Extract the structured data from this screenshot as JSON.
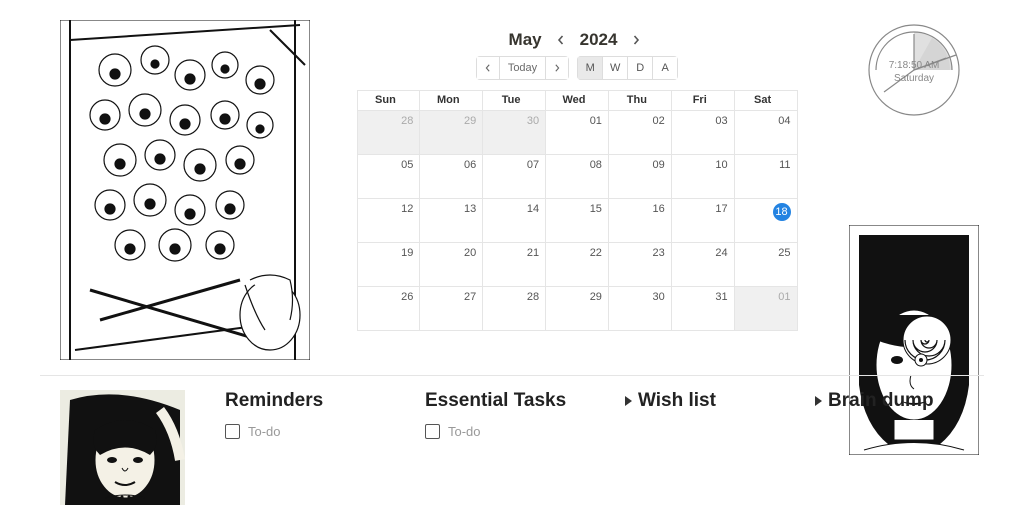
{
  "calendar": {
    "month": "May",
    "year": "2024",
    "today_label": "Today",
    "views": {
      "m": "M",
      "w": "W",
      "d": "D",
      "a": "A",
      "active": "M"
    },
    "weekdays": [
      "Sun",
      "Mon",
      "Tue",
      "Wed",
      "Thu",
      "Fri",
      "Sat"
    ],
    "weeks": [
      [
        {
          "d": "28",
          "muted": true
        },
        {
          "d": "29",
          "muted": true
        },
        {
          "d": "30",
          "muted": true
        },
        {
          "d": "01"
        },
        {
          "d": "02"
        },
        {
          "d": "03"
        },
        {
          "d": "04"
        }
      ],
      [
        {
          "d": "05"
        },
        {
          "d": "06"
        },
        {
          "d": "07"
        },
        {
          "d": "08"
        },
        {
          "d": "09"
        },
        {
          "d": "10"
        },
        {
          "d": "11"
        }
      ],
      [
        {
          "d": "12"
        },
        {
          "d": "13"
        },
        {
          "d": "14"
        },
        {
          "d": "15"
        },
        {
          "d": "16"
        },
        {
          "d": "17"
        },
        {
          "d": "18",
          "today": true
        }
      ],
      [
        {
          "d": "19"
        },
        {
          "d": "20"
        },
        {
          "d": "21"
        },
        {
          "d": "22"
        },
        {
          "d": "23"
        },
        {
          "d": "24"
        },
        {
          "d": "25"
        }
      ],
      [
        {
          "d": "26"
        },
        {
          "d": "27"
        },
        {
          "d": "28"
        },
        {
          "d": "29"
        },
        {
          "d": "30"
        },
        {
          "d": "31"
        },
        {
          "d": "01",
          "muted": true
        }
      ]
    ]
  },
  "clock": {
    "time": "7:18:50 AM",
    "day": "Saturday"
  },
  "sections": {
    "reminders": {
      "title": "Reminders",
      "todo": "To-do"
    },
    "essential": {
      "title": "Essential Tasks",
      "todo": "To-do"
    },
    "wish": {
      "title": "Wish list"
    },
    "brain": {
      "title": "Brain dump"
    }
  }
}
